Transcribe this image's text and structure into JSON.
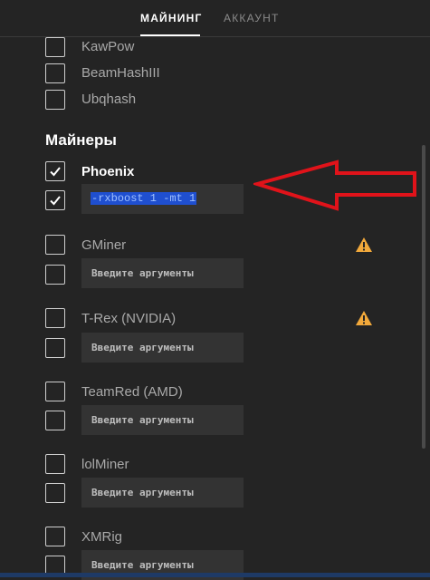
{
  "tabs": {
    "mining": "МАЙНИНГ",
    "account": "АККАУНТ"
  },
  "algorithms": [
    {
      "name": "KawPow"
    },
    {
      "name": "BeamHashIII"
    },
    {
      "name": "Ubqhash"
    }
  ],
  "section_title": "Майнеры",
  "args_placeholder": "Введите аргументы",
  "miners": [
    {
      "name": "Phoenix",
      "enabled": true,
      "args_enabled": true,
      "args_value": "-rxboost 1 -mt 1",
      "warning": false
    },
    {
      "name": "GMiner",
      "enabled": false,
      "args_enabled": false,
      "args_value": "",
      "warning": true
    },
    {
      "name": "T-Rex (NVIDIA)",
      "enabled": false,
      "args_enabled": false,
      "args_value": "",
      "warning": true
    },
    {
      "name": "TeamRed (AMD)",
      "enabled": false,
      "args_enabled": false,
      "args_value": "",
      "warning": false
    },
    {
      "name": "lolMiner",
      "enabled": false,
      "args_enabled": false,
      "args_value": "",
      "warning": false
    },
    {
      "name": "XMRig",
      "enabled": false,
      "args_enabled": false,
      "args_value": "",
      "warning": false
    }
  ],
  "colors": {
    "background": "#242424",
    "arrow": "#e0131a",
    "warning": "#f2a93b",
    "selection": "#1f4fd0"
  }
}
